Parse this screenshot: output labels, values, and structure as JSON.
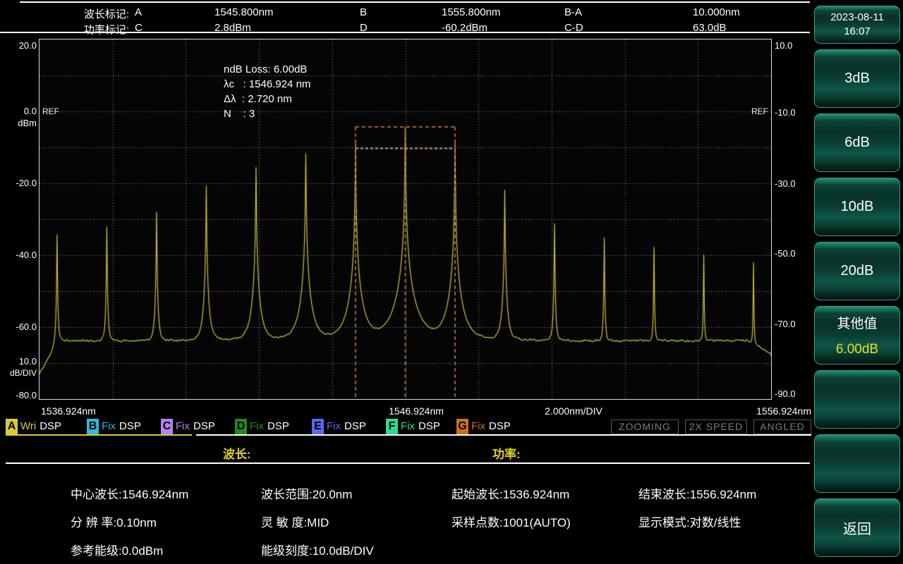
{
  "topbar": {
    "row1": {
      "label": "波长标记:",
      "m1": "A",
      "v1": "1545.800nm",
      "m2": "B",
      "v2": "1555.800nm",
      "m3": "B-A",
      "v3": "10.000nm"
    },
    "row2": {
      "label": "功率标记:",
      "m1": "C",
      "v1": "2.8dBm",
      "m2": "D",
      "v2": "-60.2dBm",
      "m3": "C-D",
      "v3": "63.0dB"
    }
  },
  "datetime": {
    "date": "2023-08-11",
    "time": "16:07"
  },
  "sidebar": {
    "threshold_buttons": [
      "3dB",
      "6dB",
      "10dB",
      "20dB"
    ],
    "other": {
      "label": "其他值",
      "value": "6.00dB",
      "value_color": "#e8df1f"
    },
    "empty_count": 2,
    "back_label": "返回"
  },
  "plot": {
    "annotation_lines": [
      "ndB Loss: 6.00dB",
      "λc   : 1546.924 nm",
      "Δλ  : 2.720 nm",
      "N    : 3"
    ],
    "ref_label": "REF",
    "left_axis": [
      "20.0",
      "0.0",
      "dBm",
      "-20.0",
      "-40.0",
      "-60.0",
      "10.0",
      "dB/DIV",
      "-80.0"
    ],
    "right_axis": [
      "10.0",
      "-10.0",
      "-30.0",
      "-50.0",
      "-70.0",
      "-90.0"
    ],
    "x_axis": {
      "start": "1536.924nm",
      "center": "1546.924nm",
      "per_div": "2.000nm/DIV",
      "end": "1556.924nm"
    }
  },
  "traces": [
    {
      "letter": "A",
      "mode": "Wri",
      "type": "DSP",
      "color": "#d6cc3c",
      "active": true
    },
    {
      "letter": "B",
      "mode": "Fix",
      "type": "DSP",
      "color": "#35b5dd",
      "active": false
    },
    {
      "letter": "C",
      "mode": "Fix",
      "type": "DSP",
      "color": "#b583ef",
      "active": false
    },
    {
      "letter": "D",
      "mode": "Fix",
      "type": "DSP",
      "color": "#1e8a1e",
      "active": false
    },
    {
      "letter": "E",
      "mode": "Fix",
      "type": "DSP",
      "color": "#5a67ee",
      "active": false
    },
    {
      "letter": "F",
      "mode": "Fix",
      "type": "DSP",
      "color": "#2cdd96",
      "active": false
    },
    {
      "letter": "G",
      "mode": "Fix",
      "type": "DSP",
      "color": "#cf6f14",
      "active": false
    }
  ],
  "status_buttons": [
    "ZOOMING",
    "2X SPEED",
    "ANGLED"
  ],
  "sections": {
    "wavelength_header": "波长:",
    "power_header": "功率:"
  },
  "params": {
    "rows": [
      [
        "中心波长:1546.924nm",
        "波长范围:20.0nm",
        "起始波长:1536.924nm",
        "结束波长:1556.924nm"
      ],
      [
        "分 辨 率:0.10nm",
        "灵 敏 度:MID",
        "采样点数:1001(AUTO)",
        "显示模式:对数/线性"
      ],
      [
        "参考能级:0.0dBm",
        "能级刻度:10.0dB/DIV"
      ]
    ]
  },
  "chart_data": {
    "type": "line",
    "title": "optical comb spectrum",
    "x_range": [
      1536.924,
      1556.924
    ],
    "x_div_nm": 2.0,
    "y_range_left_dbm": [
      -80,
      20
    ],
    "y_div_db": 10,
    "right_axis_offset_db": -10,
    "ref_level_dbm": 0.0,
    "trace_color": "#d4c63a",
    "grid_color": "#989898",
    "noise_floor_dbm": -63.8,
    "left_edge_dbm": -73.0,
    "left_edge_end_nm": 1537.45,
    "right_edge_start_nm": 1556.3,
    "right_edge_dbm": -67.5,
    "peaks": [
      {
        "nm": 1537.404,
        "dbm": -34.2
      },
      {
        "nm": 1538.764,
        "dbm": -32.0
      },
      {
        "nm": 1540.124,
        "dbm": -28.0
      },
      {
        "nm": 1541.484,
        "dbm": -20.7
      },
      {
        "nm": 1542.844,
        "dbm": -15.5
      },
      {
        "nm": 1544.204,
        "dbm": -11.7
      },
      {
        "nm": 1545.564,
        "dbm": -8.7
      },
      {
        "nm": 1546.924,
        "dbm": -4.3
      },
      {
        "nm": 1548.284,
        "dbm": -8.7
      },
      {
        "nm": 1549.644,
        "dbm": -21.8
      },
      {
        "nm": 1551.004,
        "dbm": -31.2
      },
      {
        "nm": 1552.364,
        "dbm": -35.1
      },
      {
        "nm": 1553.724,
        "dbm": -37.7
      },
      {
        "nm": 1555.084,
        "dbm": -39.9
      },
      {
        "nm": 1556.444,
        "dbm": -42.0
      }
    ],
    "ndb_band": {
      "loss_db": 6.0,
      "center_nm": 1546.924,
      "left_nm": 1545.564,
      "right_nm": 1548.284,
      "top_dbm": -4.3,
      "n_peaks": 3,
      "box_color": "#a5633d",
      "loss_line_color": "#d89b7e"
    }
  }
}
